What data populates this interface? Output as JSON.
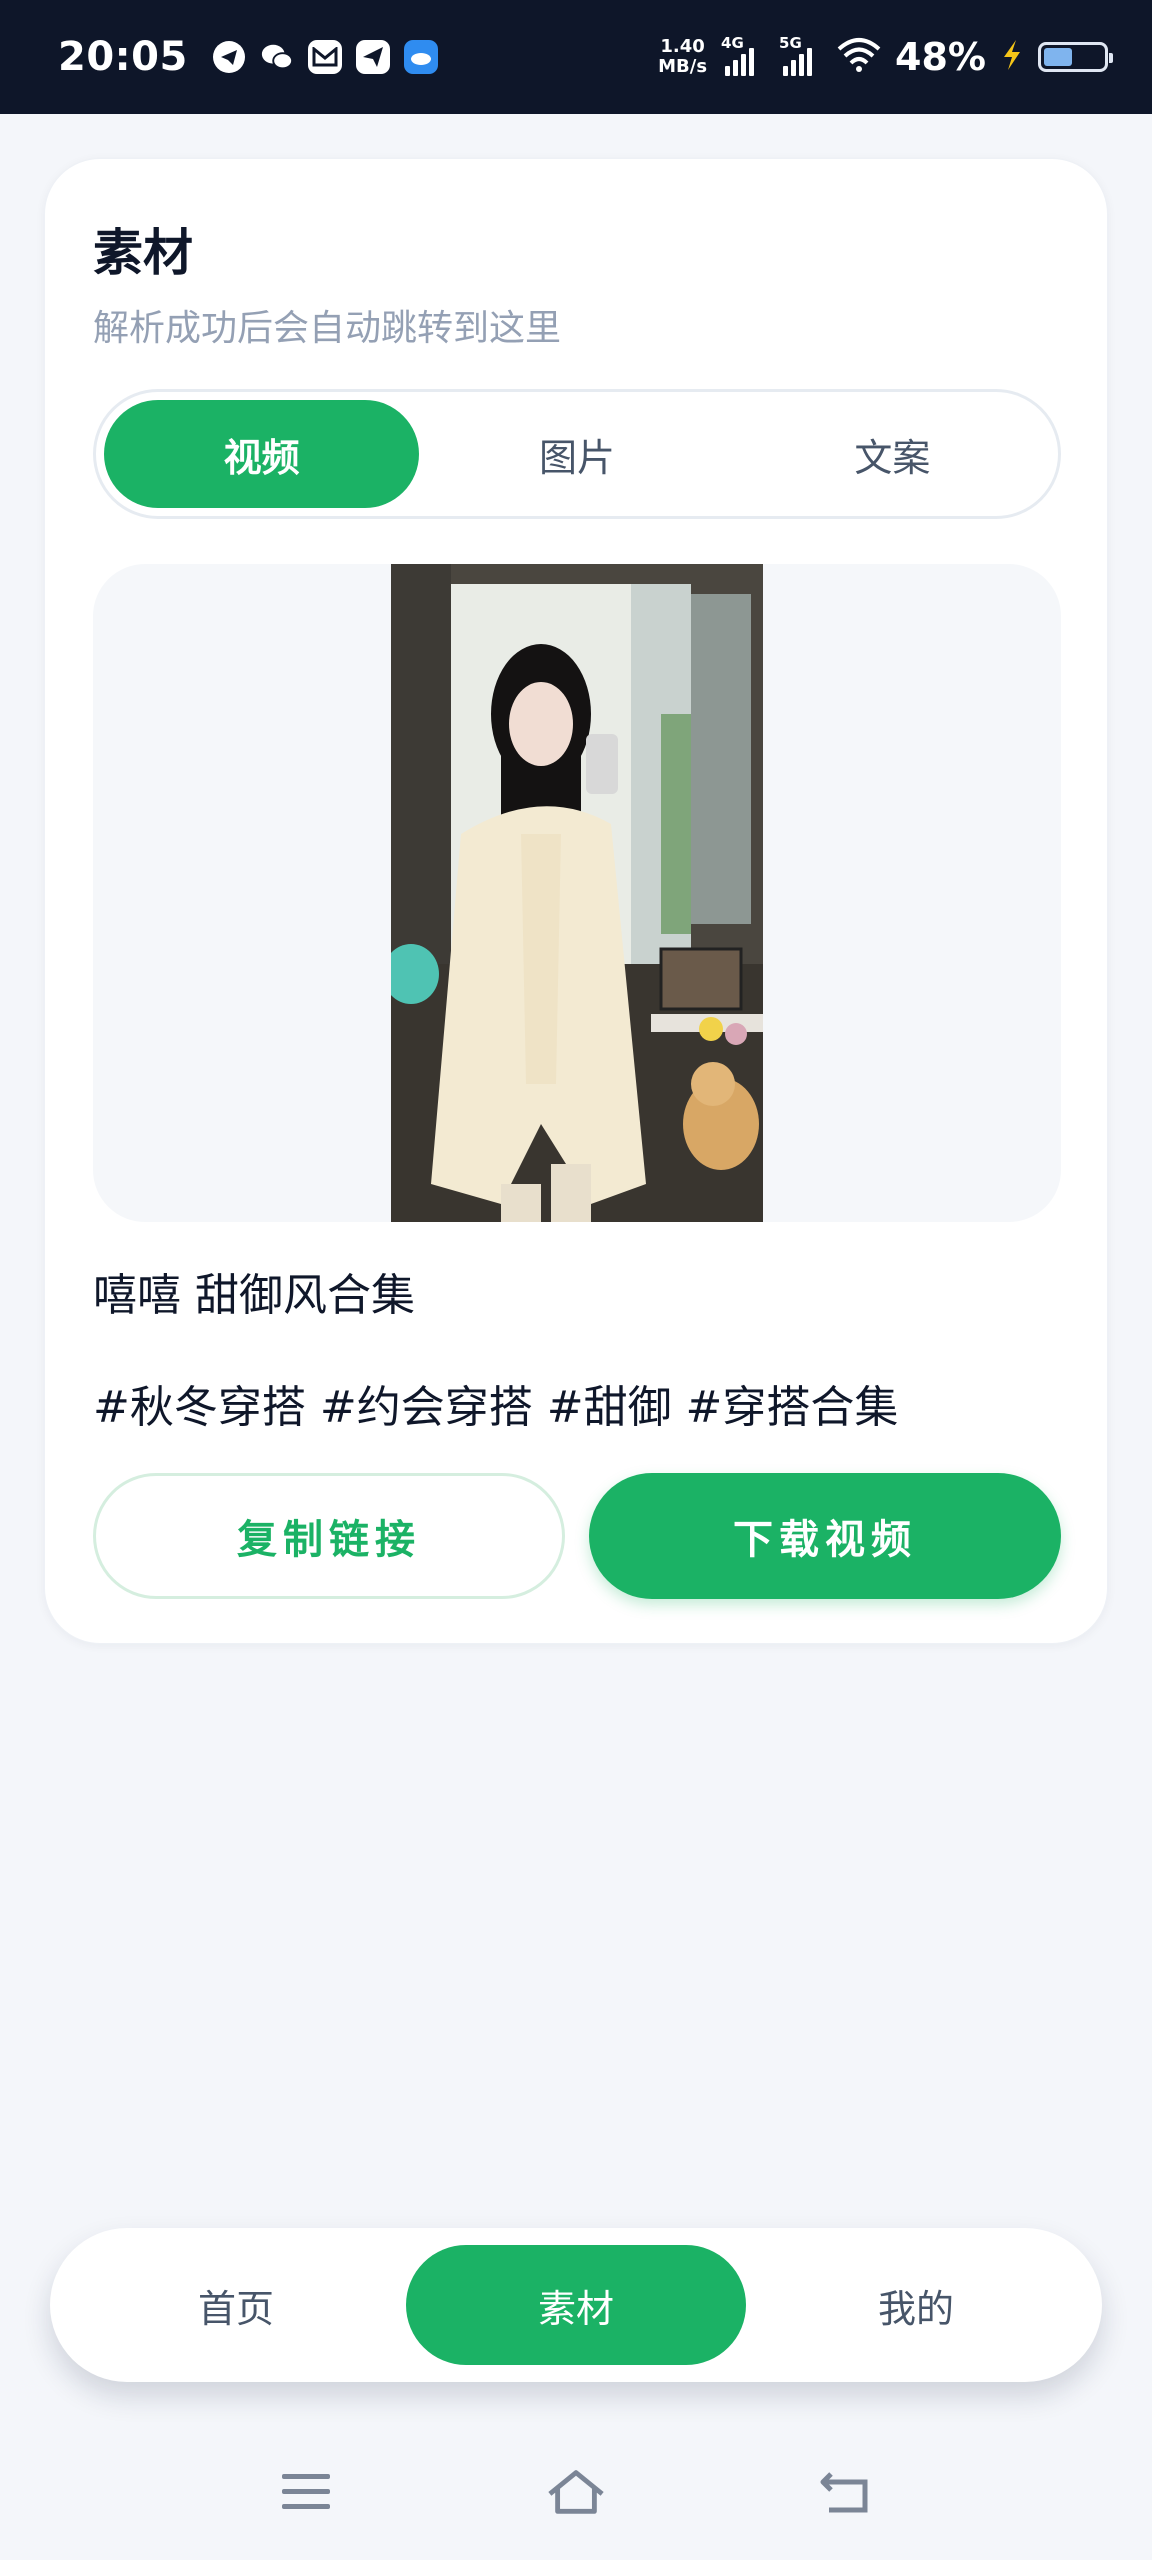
{
  "status_bar": {
    "time": "20:05",
    "speed_value": "1.40",
    "speed_unit": "MB/s",
    "net1": "4G",
    "net2": "5G",
    "battery": "48%",
    "battery_level": 0.48,
    "app_icons": [
      "telegram-icon",
      "wechat-icon",
      "gmail-icon",
      "send-icon",
      "cloud-app-icon"
    ]
  },
  "card": {
    "title": "素材",
    "subtitle": "解析成功后会自动跳转到这里",
    "tabs": [
      {
        "label": "视频",
        "active": true
      },
      {
        "label": "图片",
        "active": false
      },
      {
        "label": "文案",
        "active": false
      }
    ],
    "post_title": "嘻嘻 甜御风合集",
    "post_tags": "#秋冬穿搭 #约会穿搭 #甜御 #穿搭合集",
    "copy_button": "复制链接",
    "download_button": "下载视频"
  },
  "bottom_nav": {
    "items": [
      {
        "label": "首页",
        "active": false
      },
      {
        "label": "素材",
        "active": true
      },
      {
        "label": "我的",
        "active": false
      }
    ]
  },
  "colors": {
    "accent": "#1bb265",
    "status_bar_bg": "#0e1629",
    "page_bg": "#f4f6fa"
  }
}
